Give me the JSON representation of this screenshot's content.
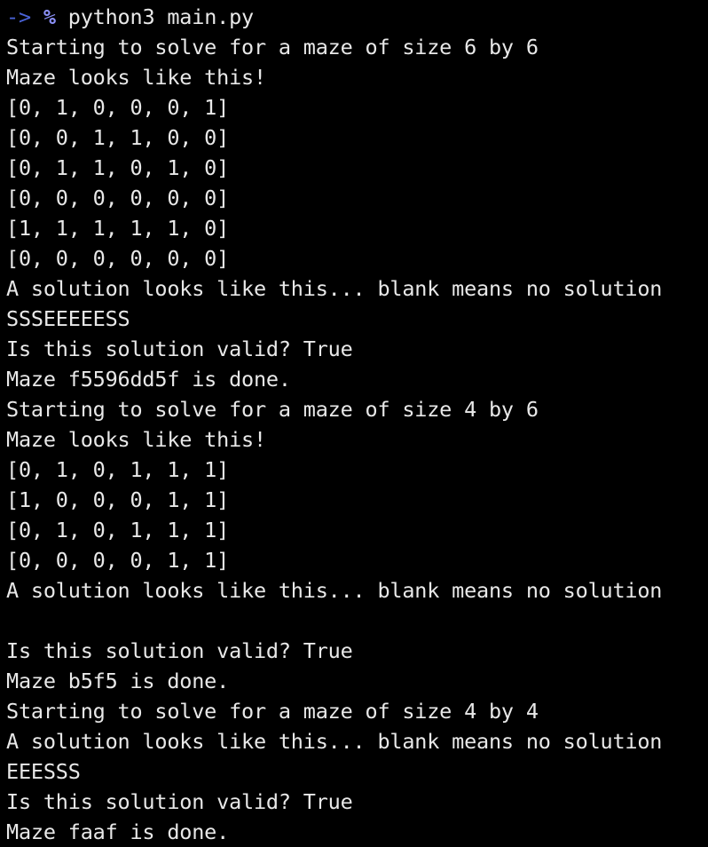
{
  "terminal": {
    "prompt": {
      "arrow": "->",
      "symbol": "%",
      "command": "python3 main.py"
    },
    "output_lines": [
      "Starting to solve for a maze of size 6 by 6",
      "Maze looks like this!",
      "[0, 1, 0, 0, 0, 1]",
      "[0, 0, 1, 1, 0, 0]",
      "[0, 1, 1, 0, 1, 0]",
      "[0, 0, 0, 0, 0, 0]",
      "[1, 1, 1, 1, 1, 0]",
      "[0, 0, 0, 0, 0, 0]",
      "A solution looks like this... blank means no solution",
      "SSSEEEEESS",
      "Is this solution valid? True",
      "Maze f5596dd5f is done.",
      "Starting to solve for a maze of size 4 by 6",
      "Maze looks like this!",
      "[0, 1, 0, 1, 1, 1]",
      "[1, 0, 0, 0, 1, 1]",
      "[0, 1, 0, 1, 1, 1]",
      "[0, 0, 0, 0, 1, 1]",
      "A solution looks like this... blank means no solution",
      "",
      "Is this solution valid? True",
      "Maze b5f5 is done.",
      "Starting to solve for a maze of size 4 by 4",
      "A solution looks like this... blank means no solution",
      "EEESSS",
      "Is this solution valid? True",
      "Maze faaf is done."
    ],
    "colors": {
      "background": "#000000",
      "text": "#e8e8e8",
      "prompt_arrow": "#4a63d8",
      "prompt_symbol": "#8a8ff5"
    }
  }
}
